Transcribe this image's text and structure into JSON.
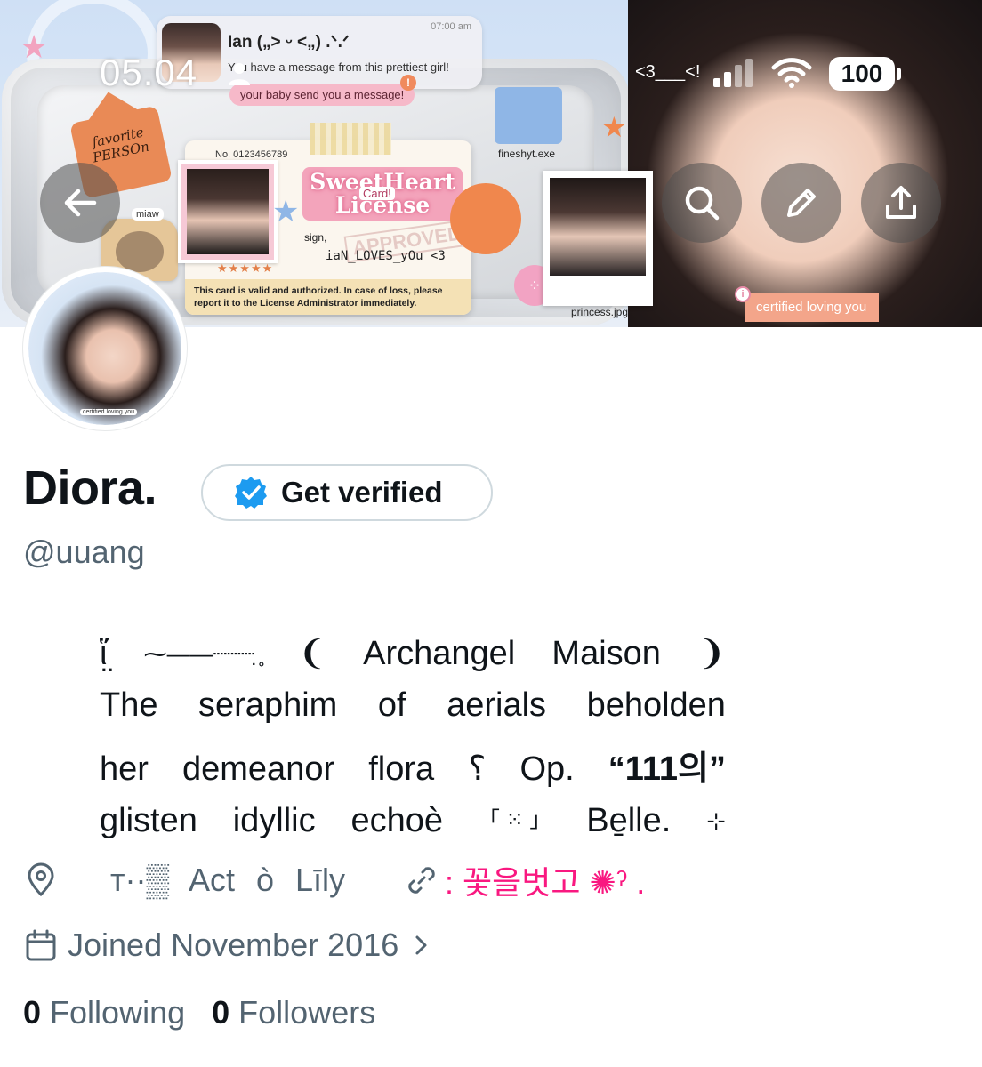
{
  "status_bar": {
    "time": "05.04",
    "carrier": "<3___<!",
    "battery": "100"
  },
  "banner": {
    "notification": {
      "sender": "Ian („> ᵕ <„) .ᐠ.ᐟ",
      "time": "07:00 am",
      "body": "You have a message from this prettiest girl!",
      "pill": "your baby send you a message!",
      "alert": "!"
    },
    "house_tag": "favorite PERSOn",
    "license": {
      "number": "No. 0123456789",
      "title": "SweetHeart License",
      "card_tag": "Card!",
      "sign_label": "sign,",
      "stamp": "APPROVED",
      "signature": "iaN_LOVES_yOu <3",
      "stars": "★★★★★",
      "fine_print": "This card is valid and authorized. In case of loss, please report it to the License Administrator immediately."
    },
    "miaw": "miaw",
    "folder_label": "fineshyt.exe",
    "polaroid_label": "princess.jpg",
    "cert_tag": "certified loving you",
    "cert_dot": "i"
  },
  "avatar_caption": "certified loving you",
  "profile": {
    "display_name": "Diora.",
    "verify_label": "Get verified",
    "handle": "@uuang",
    "bio": [
      [
        "ἵ̤",
        "⁓――┈┈┈ ̥̣",
        "❨",
        "Archangel",
        "Maison",
        "❩"
      ],
      [
        "The",
        "seraphim",
        "of",
        "aerials",
        "beholden"
      ],
      [
        "her",
        "demeanor",
        "flora",
        "⸮",
        "Op.",
        "“111의”"
      ],
      [
        "glisten",
        "idyllic",
        "echoè",
        "「 ⁙ 」",
        "Be̱lle.",
        "⊹"
      ]
    ],
    "location": "ᴛ··▒ Act ò Līly",
    "link": ": 꽃을벗고 ✺ˀ .",
    "joined": "Joined November 2016",
    "following_count": "0",
    "following_label": "Following",
    "followers_count": "0",
    "followers_label": "Followers"
  },
  "colors": {
    "text": "#0f1419",
    "secondary": "#536471",
    "link": "#f91880",
    "verified": "#1d9bf0"
  },
  "icons": [
    "back-arrow-icon",
    "search-icon",
    "edit-pencil-icon",
    "share-icon",
    "verified-badge-icon",
    "location-pin-icon",
    "link-icon",
    "calendar-icon",
    "chevron-right-icon"
  ]
}
